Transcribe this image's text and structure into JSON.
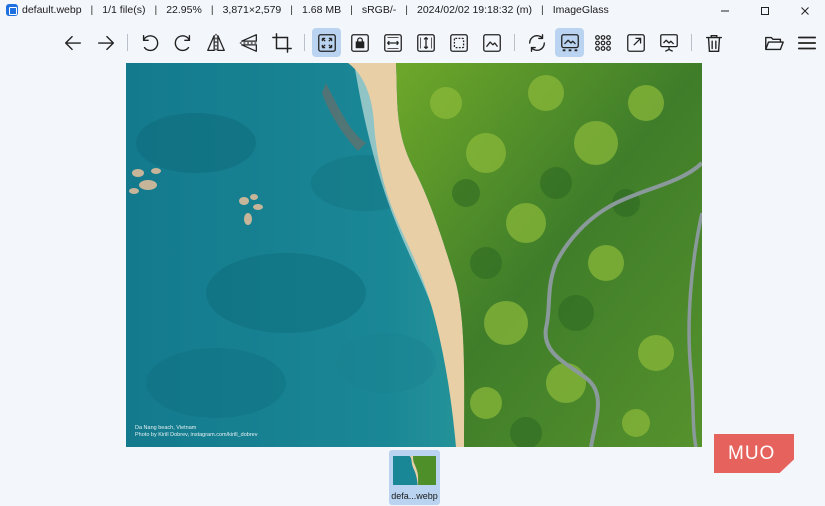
{
  "titlebar": {
    "file_name": "default.webp",
    "file_count": "1/1 file(s)",
    "zoom": "22.95%",
    "dimensions": "3,871×2,579",
    "file_size": "1.68 MB",
    "color_profile": "sRGB/-",
    "modified": "2024/02/02 19:18:32 (m)",
    "app_name": "ImageGlass",
    "separator": "|"
  },
  "toolbar": {
    "icons": [
      "arrow-left-icon",
      "arrow-right-icon",
      "rotate-left-icon",
      "rotate-right-icon",
      "flip-horizontal-icon",
      "flip-vertical-icon",
      "crop-icon",
      "auto-zoom-icon",
      "lock-zoom-icon",
      "scale-to-width-icon",
      "scale-to-height-icon",
      "scale-to-fit-icon",
      "scale-to-fill-icon",
      "refresh-icon",
      "thumbnail-bar-icon",
      "gallery-grid-icon",
      "fullscreen-icon",
      "slideshow-icon",
      "delete-icon",
      "open-folder-icon",
      "menu-icon"
    ],
    "active": [
      "auto-zoom-icon",
      "thumbnail-bar-icon"
    ]
  },
  "viewer": {
    "caption_line1": "Da Nang beach, Vietnam",
    "caption_line2": "Photo by Kirill Dobrev, instagram.com/kirill_dobrev"
  },
  "thumbnail": {
    "label": "defa...webp"
  },
  "watermark": {
    "text": "MUO"
  },
  "colors": {
    "active_bg": "#b9d3f0",
    "sea": "#1f8a99",
    "forest": "#4f8f2a",
    "sand": "#e8cfa6",
    "watermark": "#e6625c"
  }
}
